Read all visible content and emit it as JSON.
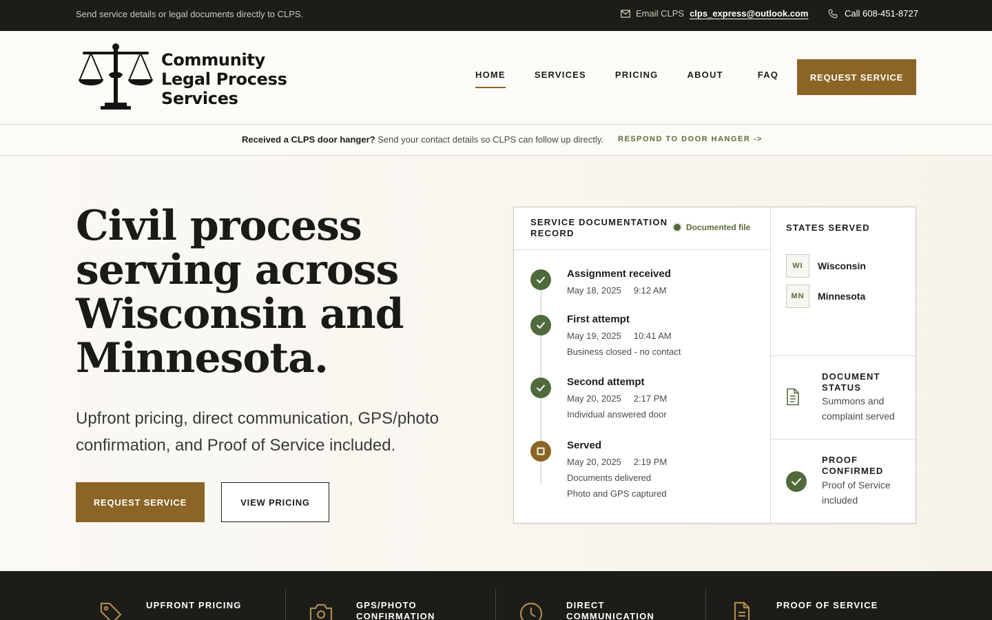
{
  "topbar": {
    "message": "Send service details or legal documents directly to CLPS.",
    "email_label": "Email CLPS",
    "email": "clps_express@outlook.com",
    "call": "Call 608-451-8727"
  },
  "brand": {
    "line1": "Community",
    "line2": "Legal Process",
    "line3": "Services"
  },
  "nav": {
    "items": [
      "HOME",
      "SERVICES",
      "PRICING",
      "ABOUT",
      "FAQ"
    ],
    "active": "HOME",
    "cta": "REQUEST SERVICE"
  },
  "strip": {
    "bold": "Received a CLPS door hanger?",
    "text": "Send your contact details so CLPS can follow up directly.",
    "link": "RESPOND TO DOOR HANGER ->"
  },
  "hero": {
    "headline": "Civil process serving across Wisconsin and Minnesota.",
    "subhead": "Upfront pricing, direct communication, GPS/photo confirmation, and Proof of Service included.",
    "primary_button": "REQUEST SERVICE",
    "secondary_button": "VIEW PRICING"
  },
  "record": {
    "title": "SERVICE DOCUMENTATION RECORD",
    "badge": "Documented file",
    "timeline": [
      {
        "title": "Assignment received",
        "date": "May 18, 2025",
        "time": "9:12 AM",
        "notes": []
      },
      {
        "title": "First attempt",
        "date": "May 19, 2025",
        "time": "10:41 AM",
        "notes": [
          "Business closed - no contact"
        ]
      },
      {
        "title": "Second attempt",
        "date": "May 20, 2025",
        "time": "2:17 PM",
        "notes": [
          "Individual answered door"
        ]
      },
      {
        "title": "Served",
        "date": "May 20, 2025",
        "time": "2:19 PM",
        "notes": [
          "Documents delivered",
          "Photo and GPS captured"
        ]
      }
    ],
    "states_title": "STATES SERVED",
    "states": [
      {
        "code": "WI",
        "name": "Wisconsin"
      },
      {
        "code": "MN",
        "name": "Minnesota"
      }
    ],
    "document_status": {
      "title": "DOCUMENT STATUS",
      "text": "Summons and complaint served"
    },
    "proof": {
      "title": "PROOF CONFIRMED",
      "text": "Proof of Service included"
    }
  },
  "features": [
    {
      "title": "UPFRONT PRICING",
      "icon": "tag-icon"
    },
    {
      "title": "GPS/PHOTO CONFIRMATION",
      "icon": "camera-icon"
    },
    {
      "title": "DIRECT COMMUNICATION",
      "icon": "clock-icon"
    },
    {
      "title": "PROOF OF SERVICE",
      "icon": "document-icon"
    }
  ],
  "colors": {
    "accent": "#8b6526",
    "green": "#4f6a3b",
    "dark": "#1c1c19",
    "background": "#fbf9f4"
  }
}
